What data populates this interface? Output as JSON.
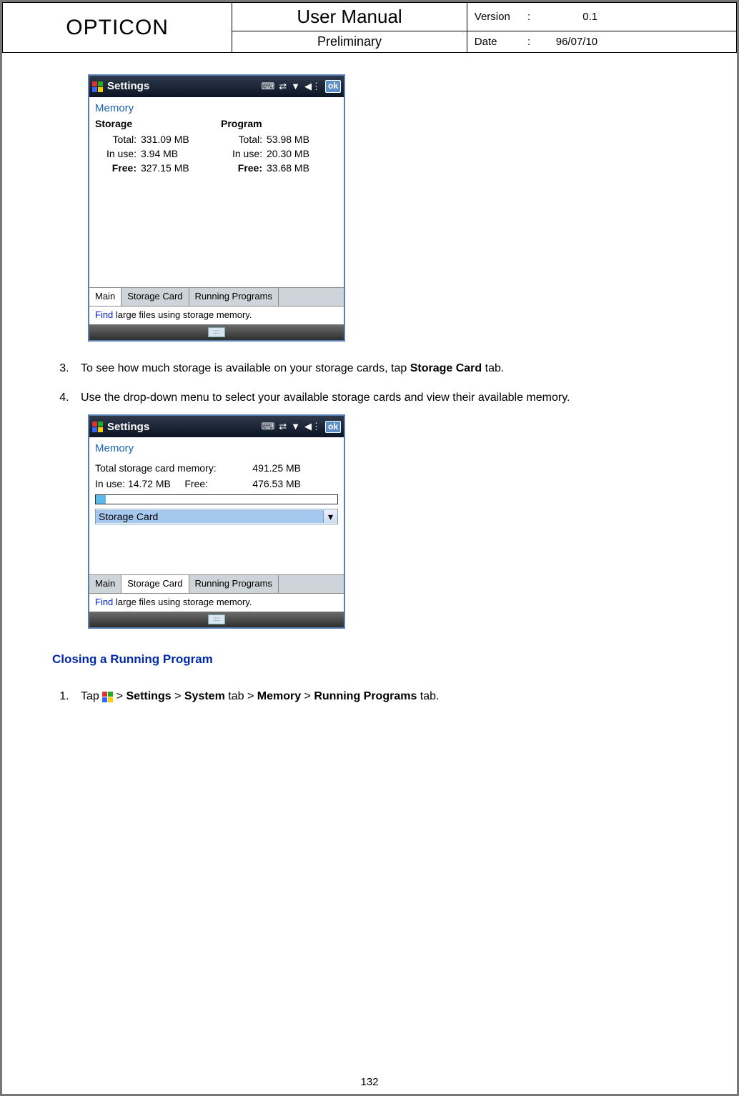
{
  "header": {
    "brand": "OPTICON",
    "title": "User Manual",
    "subtitle": "Preliminary",
    "version_label": "Version",
    "version_value": "0.1",
    "date_label": "Date",
    "date_value": "96/07/10"
  },
  "shot1": {
    "title": "Settings",
    "ok": "ok",
    "section": "Memory",
    "storage_label": "Storage",
    "program_label": "Program",
    "rows": {
      "total_label": "Total:",
      "inuse_label": "In use:",
      "free_label": "Free:",
      "storage_total": "331.09 MB",
      "storage_inuse": "3.94 MB",
      "storage_free": "327.15 MB",
      "program_total": "53.98 MB",
      "program_inuse": "20.30 MB",
      "program_free": "33.68 MB"
    },
    "tabs": {
      "main": "Main",
      "storage_card": "Storage Card",
      "running": "Running Programs"
    },
    "hint_link": "Find",
    "hint_rest": " large files using storage memory."
  },
  "steps": {
    "s3_pre": "To see how much storage is available on your storage cards, tap ",
    "s3_bold": "Storage Card",
    "s3_post": " tab.",
    "s4": "Use the drop-down menu to select your available storage cards and view their available memory."
  },
  "shot2": {
    "title": "Settings",
    "ok": "ok",
    "section": "Memory",
    "total_label": "Total storage card memory:",
    "total_value": "491.25 MB",
    "inuse_label": "In use:",
    "inuse_value": "14.72 MB",
    "free_label": "Free:",
    "free_value": "476.53 MB",
    "dd_selected": "Storage Card",
    "tabs": {
      "main": "Main",
      "storage_card": "Storage Card",
      "running": "Running Programs"
    },
    "hint_link": "Find",
    "hint_rest": " large files using storage memory."
  },
  "closing": {
    "heading": "Closing a Running Program",
    "step1_pre": "Tap ",
    "step1_path": " > Settings > System tab > Memory > Running Programs tab.",
    "settings": "Settings",
    "system_tab": "System",
    "memory": "Memory",
    "running_tab": "Running Programs"
  },
  "page_number": "132"
}
